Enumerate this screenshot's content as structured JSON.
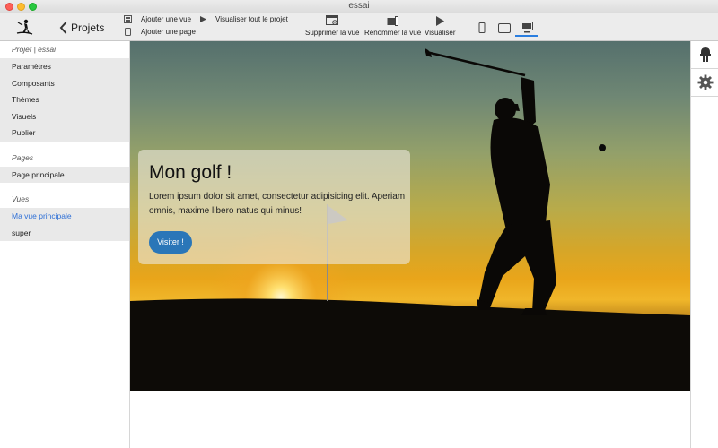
{
  "window": {
    "title": "essai"
  },
  "toolbar": {
    "back_label": "Projets",
    "add_view": "Ajouter une vue",
    "add_page": "Ajouter une page",
    "preview_project": "Visualiser tout le projet",
    "delete_view": "Supprimer la vue",
    "rename_view": "Renommer la vue",
    "preview": "Visualiser"
  },
  "sidebar": {
    "project_heading": "Projet | essai",
    "project_items": [
      "Paramètres",
      "Composants",
      "Thèmes",
      "Visuels",
      "Publier"
    ],
    "pages_heading": "Pages",
    "pages_items": [
      "Page principale"
    ],
    "views_heading": "Vues",
    "views_items": [
      "Ma vue principale",
      "super"
    ]
  },
  "hero": {
    "title": "Mon golf !",
    "text": "Lorem ipsum dolor sit amet, consectetur adipisicing elit. Aperiam omnis, maxime libero natus qui minus!",
    "button": "Visiter !"
  },
  "colors": {
    "accent": "#2a7ee0",
    "button": "#2a76b8",
    "active_link": "#2d6fd6"
  },
  "icons": {
    "right_panel": [
      "plug-icon",
      "gear-icon"
    ]
  }
}
